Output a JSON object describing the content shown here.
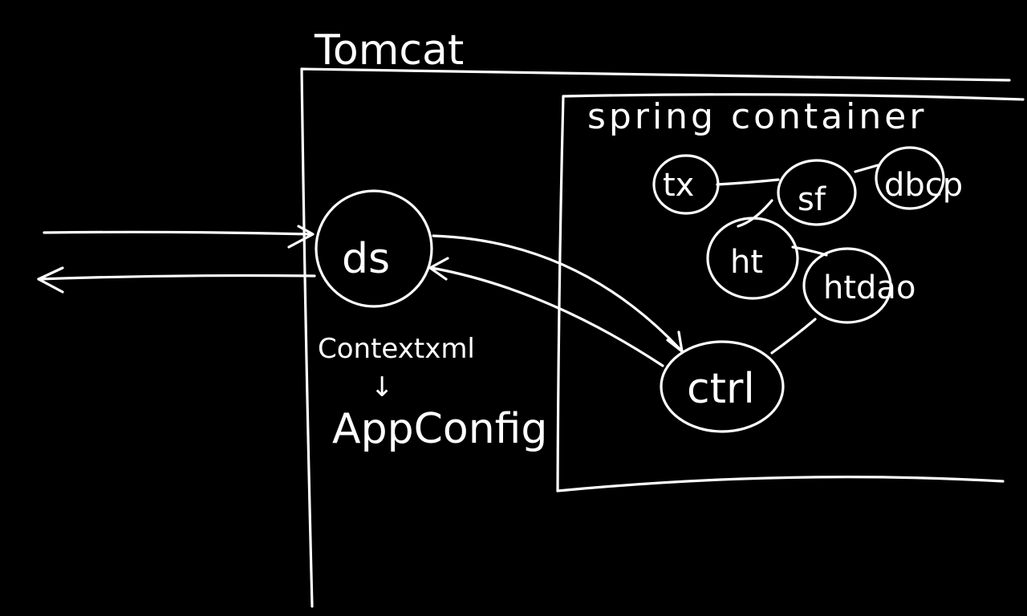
{
  "diagram": {
    "colors": {
      "background": "#000000",
      "ink": "#ffffff"
    },
    "labels": {
      "tomcat": "Tomcat",
      "spring_container": "spring container",
      "context_xml": "Contextxml",
      "arrow_symbol": "↓",
      "app_config": "AppConfig"
    },
    "nodes": {
      "ds": "ds",
      "tx": "tx",
      "sf": "sf",
      "dbcp": "dbcp",
      "ht": "ht",
      "htdao": "htdao",
      "ctrl": "ctrl"
    }
  }
}
